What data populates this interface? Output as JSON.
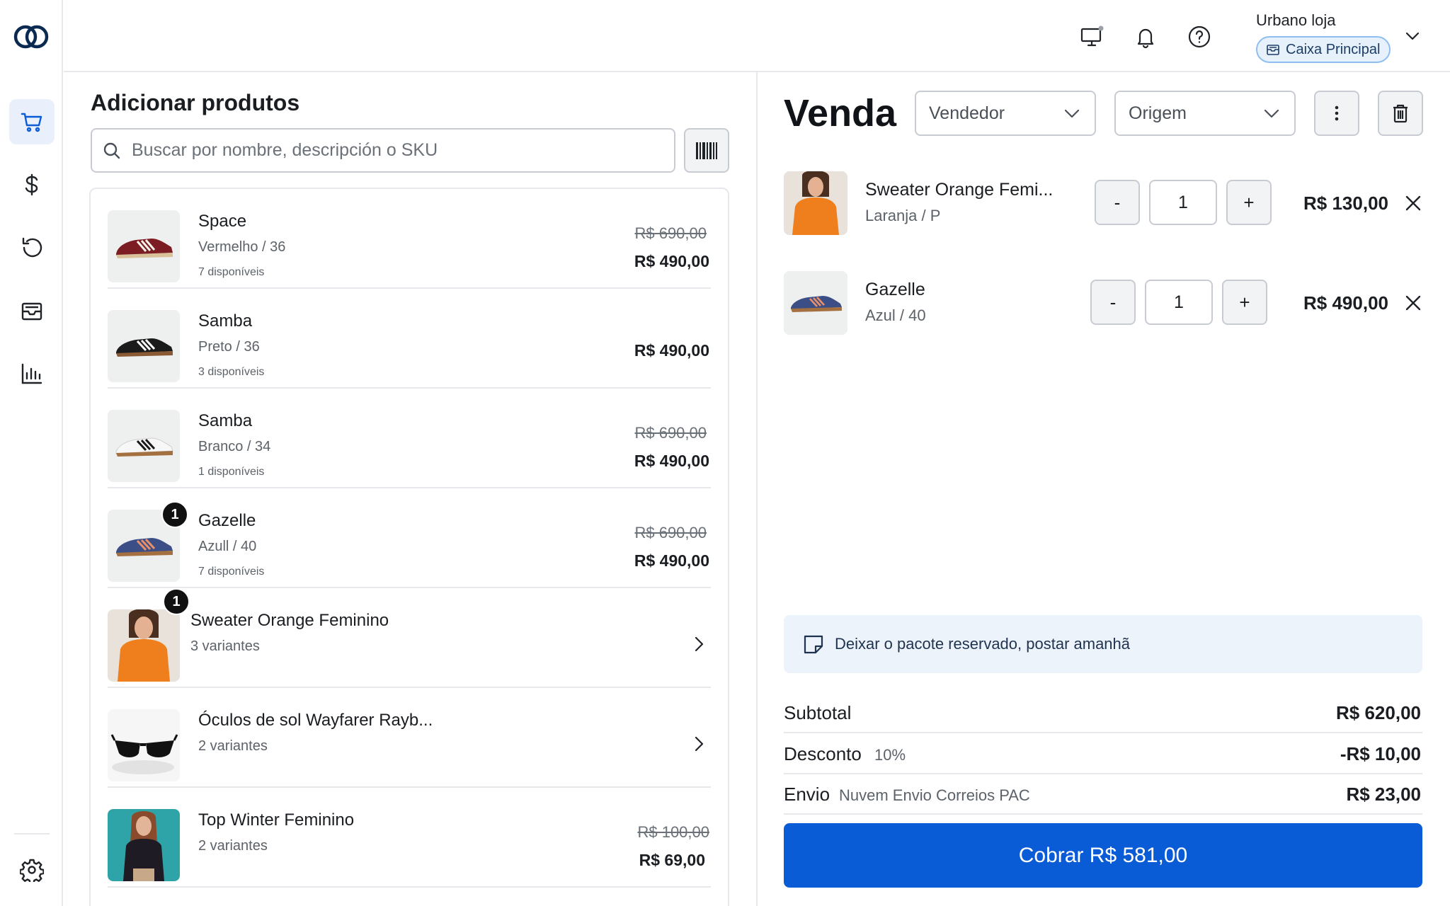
{
  "sidebar": {
    "items": [
      {
        "name": "cart",
        "label": "Vendas"
      },
      {
        "name": "dollar",
        "label": "Caixa"
      },
      {
        "name": "history",
        "label": "Histórico"
      },
      {
        "name": "inbox",
        "label": "Pedidos"
      },
      {
        "name": "reports",
        "label": "Relatórios"
      }
    ],
    "settings": "settings"
  },
  "header": {
    "store_name": "Urbano loja",
    "register_name": "Caixa Principal"
  },
  "products": {
    "title": "Adicionar produtos",
    "search_placeholder": "Buscar por nombre, descripción o SKU",
    "items": [
      {
        "name": "Space",
        "variant": "Vermelho / 36",
        "stock": "7 disponíveis",
        "old_price": "R$ 690,00",
        "price": "R$ 490,00",
        "badge": ""
      },
      {
        "name": "Samba",
        "variant": "Preto / 36",
        "stock": "3 disponíveis",
        "old_price": "",
        "price": "R$ 490,00",
        "badge": ""
      },
      {
        "name": "Samba",
        "variant": "Branco / 34",
        "stock": "1 disponíveis",
        "old_price": "R$ 690,00",
        "price": "R$ 490,00",
        "badge": ""
      },
      {
        "name": "Gazelle",
        "variant": "Azull / 40",
        "stock": "7 disponíveis",
        "old_price": "R$ 690,00",
        "price": "R$ 490,00",
        "badge": "1"
      },
      {
        "name": "Sweater Orange Feminino",
        "variant": "3 variantes",
        "stock": "",
        "old_price": "",
        "price": "",
        "badge": "1"
      },
      {
        "name": "Óculos de sol Wayfarer Rayb...",
        "variant": "2 variantes",
        "stock": "",
        "old_price": "",
        "price": "",
        "badge": ""
      },
      {
        "name": "Top Winter Feminino",
        "variant": "2 variantes",
        "stock": "",
        "old_price": "R$ 100,00",
        "price": "R$ 69,00",
        "badge": ""
      }
    ]
  },
  "sale": {
    "title": "Venda",
    "seller_placeholder": "Vendedor",
    "origin_placeholder": "Origem",
    "items": [
      {
        "name": "Sweater Orange Femi...",
        "variant": "Laranja / P",
        "qty": "1",
        "price": "R$ 130,00"
      },
      {
        "name": "Gazelle",
        "variant": "Azul / 40",
        "qty": "1",
        "price": "R$ 490,00"
      }
    ],
    "minus_label": "-",
    "plus_label": "+",
    "note": "Deixar o pacote reservado, postar amanhã",
    "summary": {
      "subtotal_label": "Subtotal",
      "subtotal_value": "R$ 620,00",
      "discount_label": "Desconto",
      "discount_detail": "10%",
      "discount_value": "-R$ 10,00",
      "shipping_label": "Envio",
      "shipping_detail": "Nuvem Envio Correios PAC",
      "shipping_value": "R$ 23,00"
    },
    "charge_label": "Cobrar R$ 581,00"
  },
  "colors": {
    "primary": "#0a5bd6",
    "active_nav_bg": "#e9f0fb",
    "note_bg": "#edf3fb",
    "badge_bg": "#e6f1fc",
    "badge_border": "#8ebdf0"
  }
}
